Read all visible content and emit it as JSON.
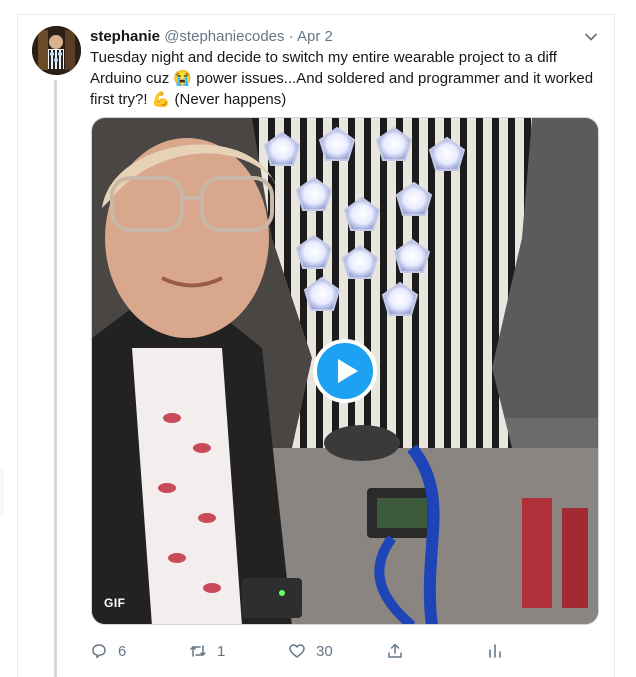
{
  "tweet": {
    "author_name": "stephanie",
    "author_handle": "@stephaniecodes",
    "separator": "·",
    "date": "Apr 2",
    "text_part1": "Tuesday night and decide to switch my entire wearable project to a diff Arduino cuz ",
    "emoji_1": "😭",
    "text_part2": " power issues...And soldered and programmer and it worked first try?! ",
    "emoji_2": "💪",
    "text_part3": " (Never happens)",
    "media_badge": "GIF",
    "reply_count": "6",
    "retweet_count": "1",
    "like_count": "30"
  },
  "icons": {
    "caret": "chevron-down-icon",
    "play": "play-icon",
    "reply": "reply-icon",
    "retweet": "retweet-icon",
    "like": "heart-icon",
    "share": "share-icon",
    "analytics": "analytics-icon"
  },
  "colors": {
    "accent": "#1da1f2",
    "secondary_text": "#657786",
    "primary_text": "#14171a",
    "border": "#e6ecf0"
  }
}
